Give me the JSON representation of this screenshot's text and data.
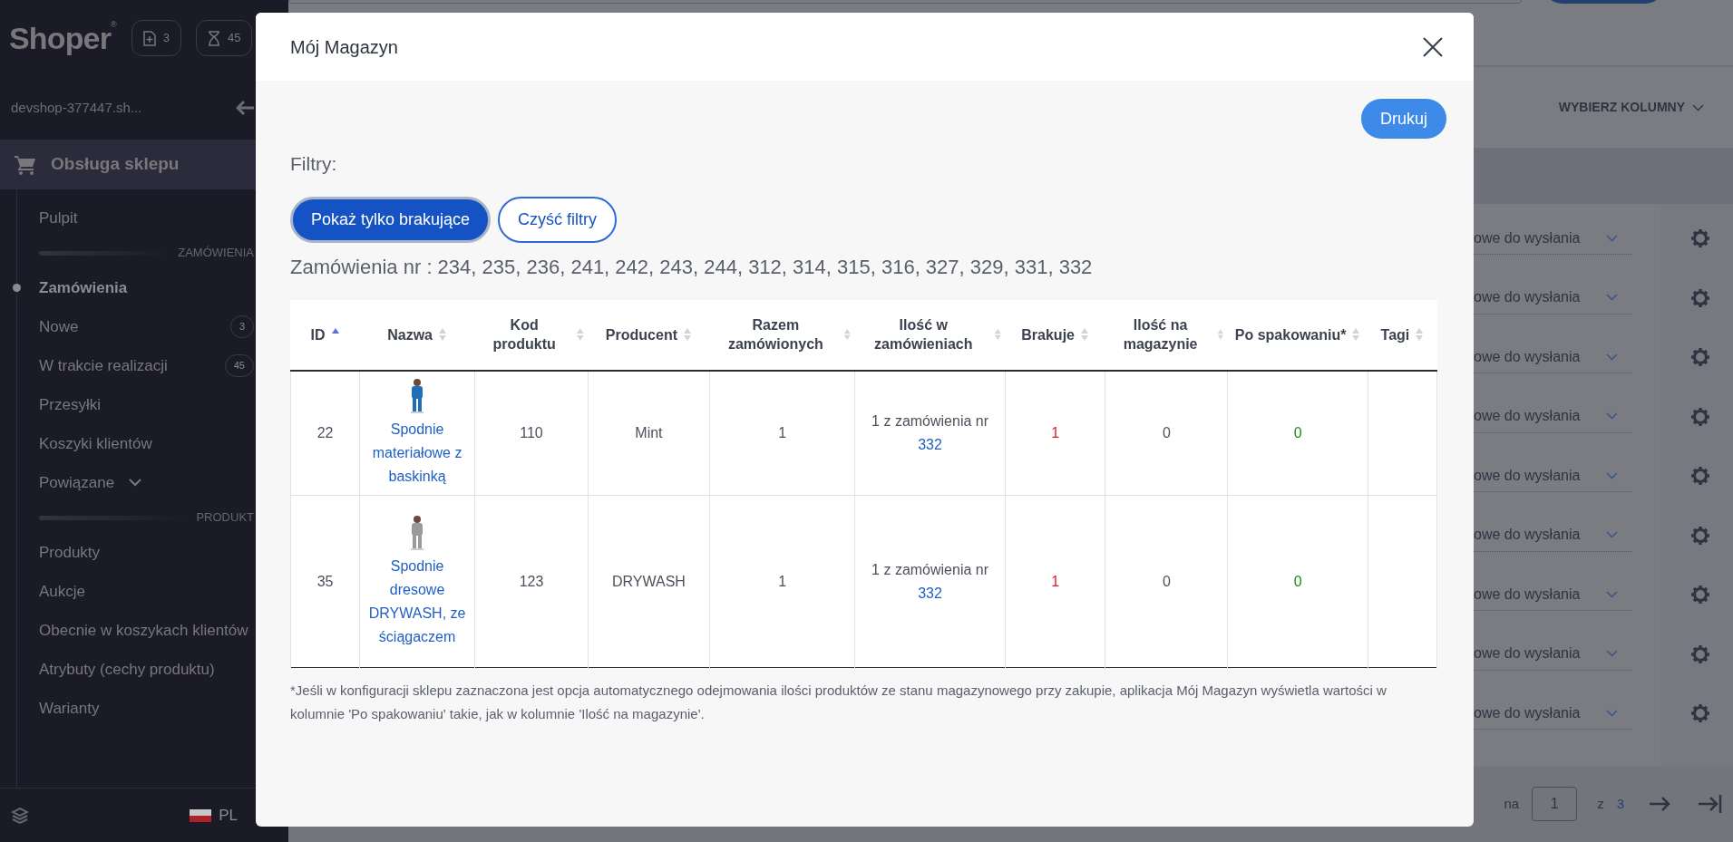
{
  "sidebar": {
    "logo": "Shoper",
    "logo_mark": "®",
    "header_badges": [
      {
        "count": "3"
      },
      {
        "count": "45"
      }
    ],
    "shop_name": "devshop-377447.sh...",
    "section": "Obsługa sklepu",
    "groups": [
      {
        "items": [
          {
            "label": "Pulpit",
            "selected": false
          }
        ]
      },
      {
        "heading": "ZAMÓWIENIA",
        "items": [
          {
            "label": "Zamówienia",
            "selected": true
          },
          {
            "label": "Nowe",
            "selected": false,
            "count": "3"
          },
          {
            "label": "W trakcie realizacji",
            "selected": false,
            "count": "45"
          },
          {
            "label": "Przesyłki",
            "selected": false
          },
          {
            "label": "Koszyki klientów",
            "selected": false
          },
          {
            "label": "Powiązane",
            "selected": false,
            "expanded": false
          }
        ]
      },
      {
        "heading": "PRODUKT",
        "items": [
          {
            "label": "Produkty",
            "selected": false
          },
          {
            "label": "Aukcje",
            "selected": false
          },
          {
            "label": "Obecnie w koszykach klientów",
            "selected": false
          },
          {
            "label": "Atrybuty (cechy produktu)",
            "selected": false
          },
          {
            "label": "Warianty",
            "selected": false
          }
        ]
      }
    ],
    "language": "PL"
  },
  "background": {
    "columns_button": "WYBIERZ KOLUMNY",
    "status_rows": [
      "owe do wysłania",
      "owe do wysłania",
      "owe do wysłania",
      "owe do wysłania",
      "owe do wysłania",
      "owe do wysłania",
      "owe do wysłania",
      "owe do wysłania",
      "owe do wysłania"
    ],
    "pagination": {
      "label": "na",
      "page": "1",
      "of": "z",
      "total": "3"
    }
  },
  "modal": {
    "title": "Mój Magazyn",
    "print_button": "Drukuj",
    "filters_label": "Filtry:",
    "filters": [
      {
        "label": "Pokaż tylko brakujące",
        "selected": true
      },
      {
        "label": "Czyść filtry",
        "selected": false
      }
    ],
    "orders_line": "Zamówienia nr : 234, 235, 236, 241, 242, 243, 244, 312, 314, 315, 316, 327, 329, 331, 332",
    "table": {
      "columns": [
        {
          "label": "ID",
          "sorted": true
        },
        {
          "label": "Nazwa",
          "sorted": false
        },
        {
          "label": "Kod produktu",
          "sorted": false
        },
        {
          "label": "Producent",
          "sorted": false
        },
        {
          "label": "Razem zamówionych",
          "sorted": false
        },
        {
          "label": "Ilość w zamówieniach",
          "sorted": false
        },
        {
          "label": "Brakuje",
          "sorted": false
        },
        {
          "label": "Ilość na magazynie",
          "sorted": false
        },
        {
          "label": "Po spakowaniu*",
          "sorted": false
        },
        {
          "label": "Tagi",
          "sorted": false
        }
      ],
      "rows": [
        {
          "id": "22",
          "name": "Spodnie materiałowe z baskinką",
          "code": "110",
          "producer": "Mint",
          "total": "1",
          "in_orders": "1 z zamówienia nr",
          "order_link": "332",
          "missing": "1",
          "in_stock": "0",
          "after_packing": "0"
        },
        {
          "id": "35",
          "name": "Spodnie dresowe DRYWASH, ze ściągaczem",
          "code": "123",
          "producer": "DRYWASH",
          "total": "1",
          "in_orders": "1 z zamówienia nr",
          "order_link": "332",
          "missing": "1",
          "in_stock": "0",
          "after_packing": "0"
        }
      ]
    },
    "footnote": "*Jeśli w konfiguracji sklepu zaznaczona jest opcja automatycznego odejmowania ilości produktów ze stanu magazynowego przy zakupie, aplikacja Mój Magazyn wyświetla wartości w kolumnie 'Po spakowaniu' takie, jak w kolumnie 'Ilość na magazynie'."
  }
}
